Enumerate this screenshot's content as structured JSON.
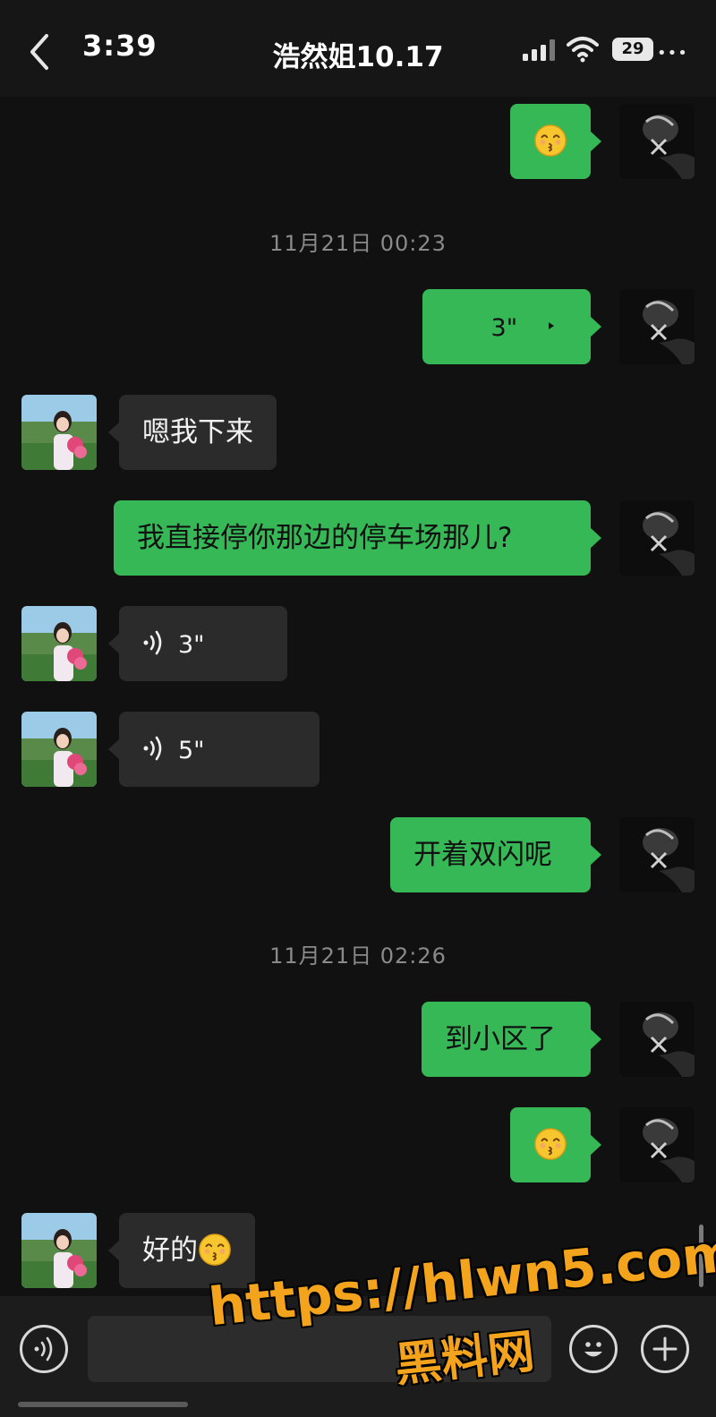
{
  "status_bar": {
    "time": "3:39",
    "battery": "29"
  },
  "header": {
    "contact_name": "浩然姐10.17"
  },
  "messages": [
    {
      "from": "me",
      "type": "emoji",
      "emoji": "kissing-face-icon"
    },
    {
      "type": "timestamp",
      "text": "11月21日 00:23"
    },
    {
      "from": "me",
      "type": "voice",
      "duration": "3\""
    },
    {
      "from": "them",
      "type": "text",
      "text": "嗯我下来"
    },
    {
      "from": "me",
      "type": "text",
      "text": "我直接停你那边的停车场那儿?"
    },
    {
      "from": "them",
      "type": "voice",
      "duration": "3\""
    },
    {
      "from": "them",
      "type": "voice",
      "duration": "5\""
    },
    {
      "from": "me",
      "type": "text",
      "text": "开着双闪呢"
    },
    {
      "type": "timestamp",
      "text": "11月21日 02:26"
    },
    {
      "from": "me",
      "type": "text",
      "text": "到小区了"
    },
    {
      "from": "me",
      "type": "emoji",
      "emoji": "kissing-face-icon"
    },
    {
      "from": "them",
      "type": "text",
      "text": "好的"
    }
  ],
  "watermark": {
    "url": "https://hlwn5.com",
    "name": "黑料网"
  },
  "colors": {
    "my_bubble": "#36b857",
    "their_bubble": "#2b2b2b",
    "background": "#111111",
    "watermark": "#f3a41c"
  }
}
